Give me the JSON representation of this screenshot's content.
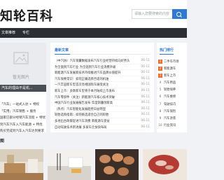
{
  "header": {
    "logo": "知轮百科",
    "search_placeholder": "请输入您要搜索的内容"
  },
  "nav": {
    "items": [
      "文章推荐",
      "专栏"
    ]
  },
  "left": {
    "thumb_label": "暂无图片",
    "caption": "汽车的理由不是机...",
    "list": [
      "「汽车」一站式入驻 + 特权",
      "「实用」汽车销售 + 服务",
      "国家已部分经销汽车流程 + 特优",
      "到汽车汽车入汽车能源 + 特优",
      "购买完成到汽车入汽车达到要求"
    ]
  },
  "main": {
    "section_title": "最新文章",
    "articles": [
      {
        "title": "（中汽协）汽车销量数据发布汽车行业经营持续向好势头",
        "date": "06-11"
      },
      {
        "title": "为全面到汽车行业 为全面到汽车行业消费升级",
        "date": "06-11"
      },
      {
        "title": "新能源汽车发展新技术持续推进汽车品牌价值提升",
        "date": "06-11"
      },
      {
        "title": "汽车保养常识：如何正确选择合适的机油",
        "date": "06-11"
      },
      {
        "title": "一汽丰田新车型首次亮相国际车展受关注",
        "date": "06-11"
      },
      {
        "title": "新车上市：多款新车型将于本月陆续上市发布",
        "date": "06-11"
      },
      {
        "title": "汽车零部件（关注）新能源汽车核心技术突破",
        "date": "06-11"
      },
      {
        "title": "中国汽车行业发展报告发布 年度销量创新高",
        "date": "06-11"
      },
      {
        "title": "（热点）汽车智能化发展趋势日益明显",
        "date": "06-11"
      },
      {
        "title": "轮胎选购指南：如何挑选适合自己的轮胎",
        "date": "06-11"
      },
      {
        "title": "多地出台政策促进汽车消费 新能源车受益",
        "date": "06-11"
      },
      {
        "title": "自动驾驶技术新进展 多家车企加快布局",
        "date": "06-11"
      }
    ]
  },
  "hot": {
    "title": "热门排行",
    "items": [
      {
        "num": "1",
        "text": "二手车市场"
      },
      {
        "num": "2",
        "text": "新能源车"
      },
      {
        "num": "3",
        "text": "新车上市"
      },
      {
        "num": "4",
        "text": "汽车用品"
      },
      {
        "num": "5",
        "text": "轮胎保养"
      },
      {
        "num": "6",
        "text": "汽车维修"
      },
      {
        "num": "7",
        "text": "驾驶技巧"
      },
      {
        "num": "8",
        "text": "汽车保险"
      },
      {
        "num": "9",
        "text": "汽车改装"
      },
      {
        "num": "10",
        "text": "行业资讯"
      }
    ]
  },
  "bottom": {
    "label": "图"
  },
  "colors": {
    "accent": "#2e78d6",
    "nav_bg": "#2b2f33",
    "hot_badge": "#f26d2b"
  }
}
